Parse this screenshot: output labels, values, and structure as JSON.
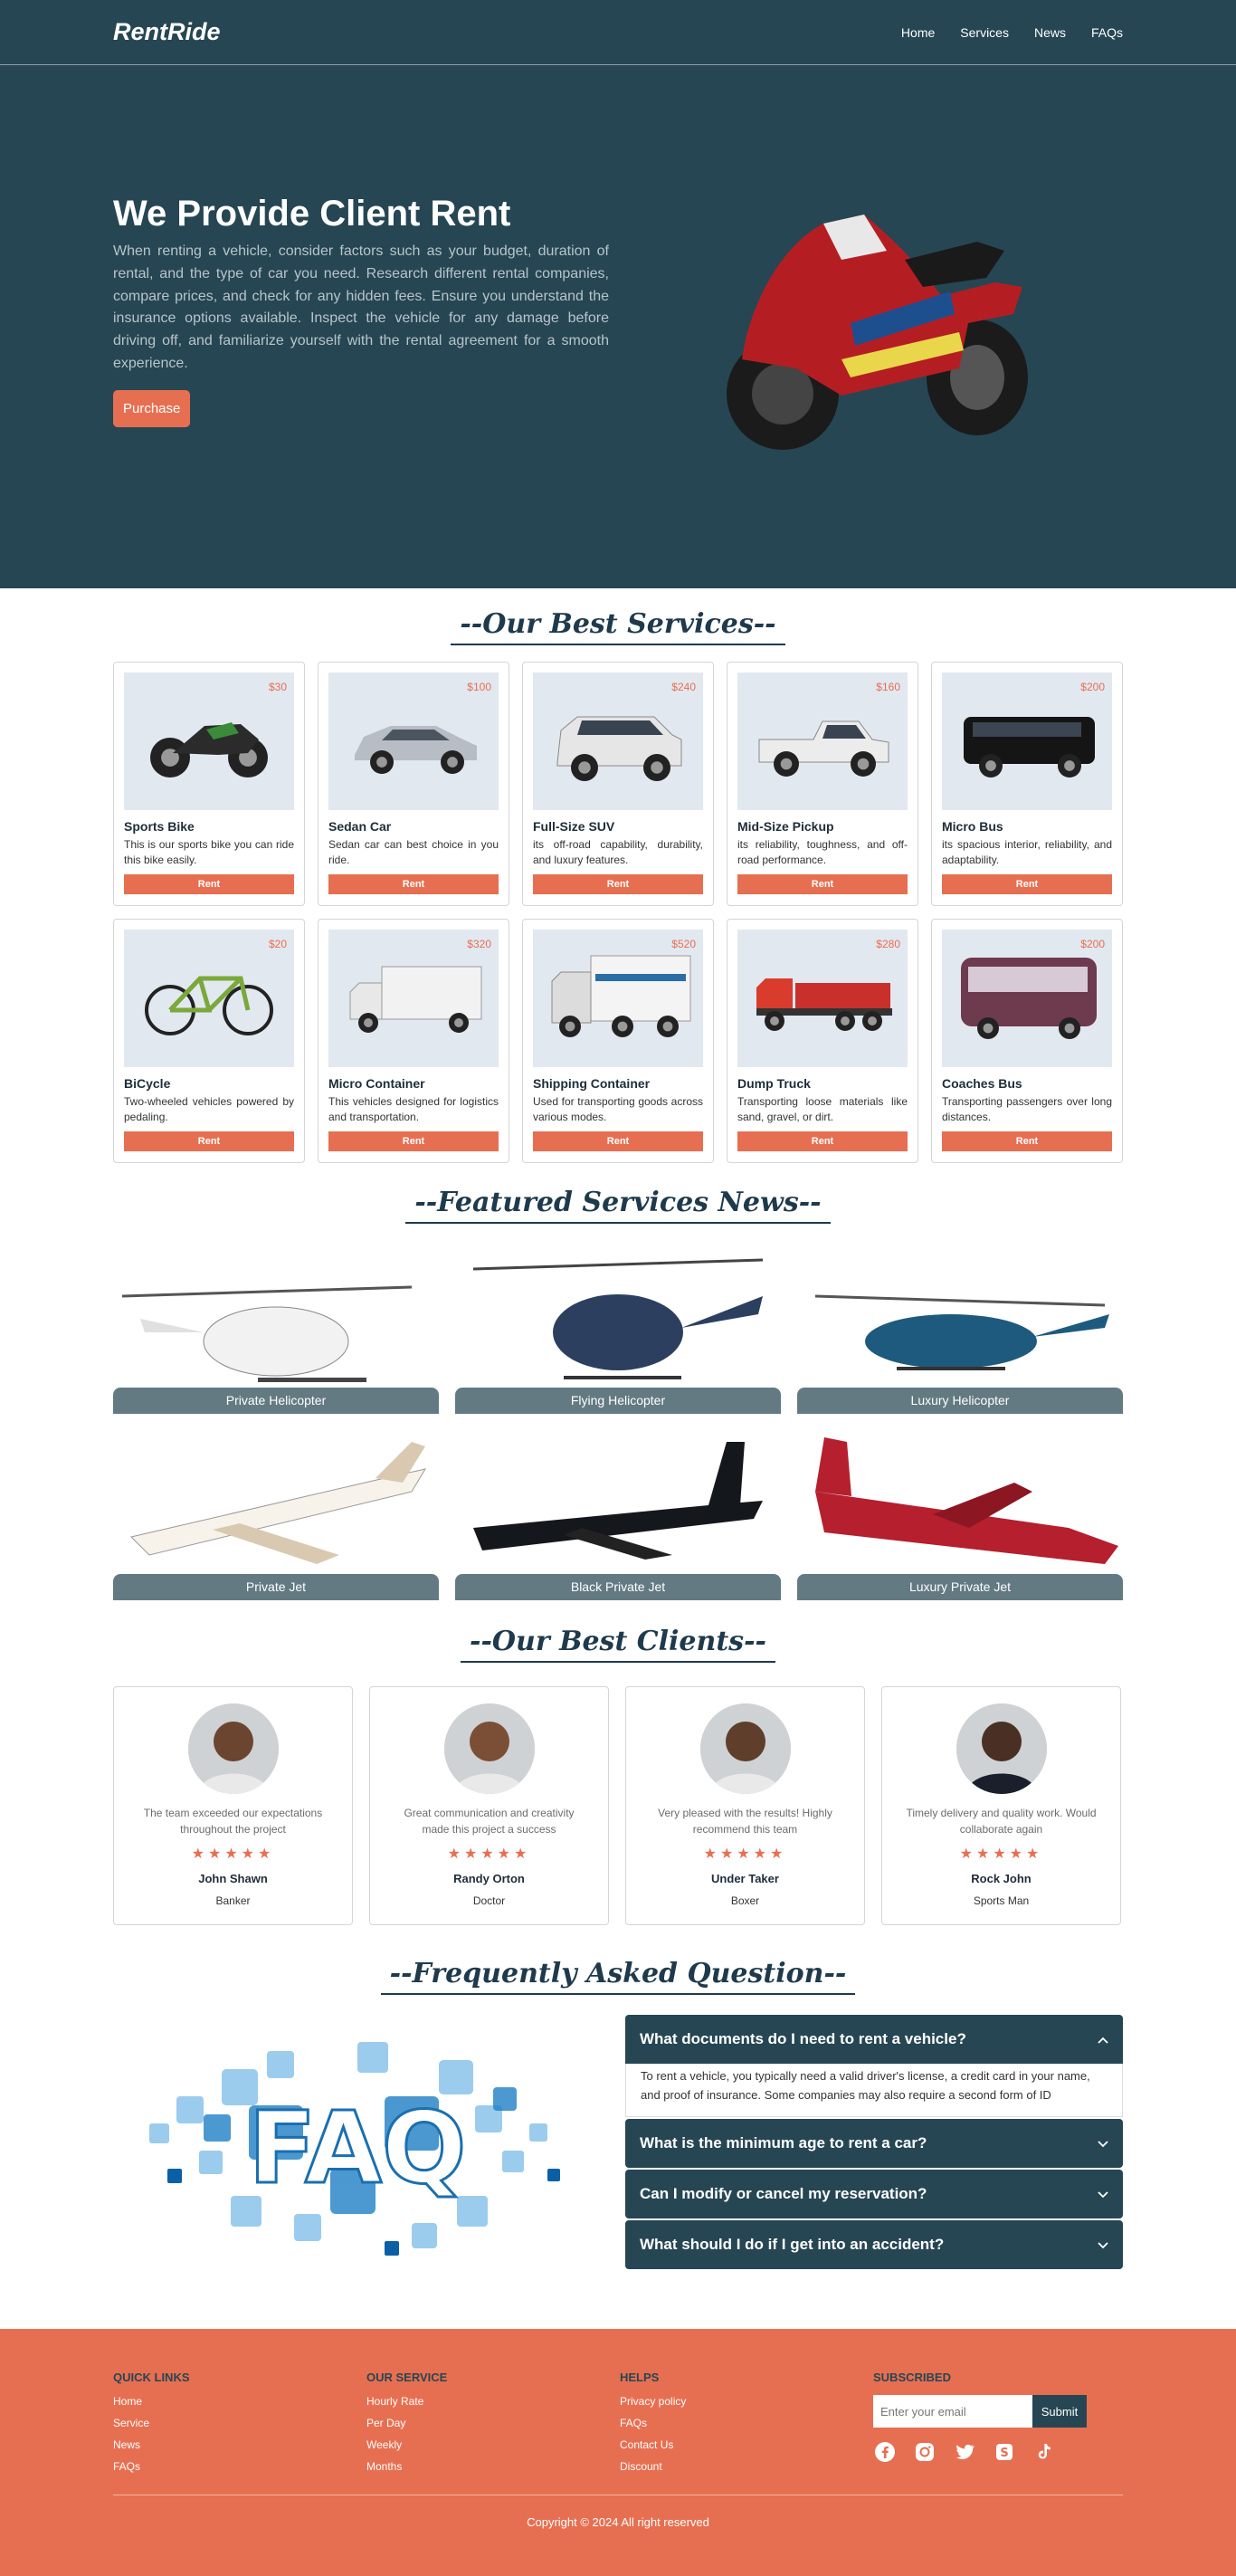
{
  "header": {
    "logo": "RentRide",
    "nav": [
      "Home",
      "Services",
      "News",
      "FAQs"
    ]
  },
  "hero": {
    "title": "We Provide Client Rent",
    "text": "When renting a vehicle, consider factors such as your budget, duration of rental, and the type of car you need. Research different rental companies, compare prices, and check for any hidden fees. Ensure you understand the insurance options available. Inspect the vehicle for any damage before driving off, and familiarize yourself with the rental agreement for a smooth experience.",
    "button": "Purchase",
    "image": "motorcycle-image"
  },
  "services": {
    "title": "--Our Best Services--",
    "items": [
      {
        "price": "$30",
        "name": "Sports Bike",
        "desc": "This is our sports bike you can ride this bike easily.",
        "button": "Rent",
        "icon": "sports-bike"
      },
      {
        "price": "$100",
        "name": "Sedan Car",
        "desc": "Sedan car can best choice in you ride.",
        "button": "Rent",
        "icon": "sedan"
      },
      {
        "price": "$240",
        "name": "Full-Size SUV",
        "desc": "its off-road capability, durability, and luxury features.",
        "button": "Rent",
        "icon": "suv"
      },
      {
        "price": "$160",
        "name": "Mid-Size Pickup",
        "desc": "its reliability, toughness, and off-road performance.",
        "button": "Rent",
        "icon": "pickup"
      },
      {
        "price": "$200",
        "name": "Micro Bus",
        "desc": "its spacious interior, reliability, and adaptability.",
        "button": "Rent",
        "icon": "micro-bus"
      },
      {
        "price": "$20",
        "name": "BiCycle",
        "desc": "Two-wheeled vehicles powered by pedaling.",
        "button": "Rent",
        "icon": "bicycle"
      },
      {
        "price": "$320",
        "name": "Micro Container",
        "desc": "This vehicles designed for logistics and transportation.",
        "button": "Rent",
        "icon": "box-truck"
      },
      {
        "price": "$520",
        "name": "Shipping Container",
        "desc": "Used for transporting goods across various modes.",
        "button": "Rent",
        "icon": "container-truck"
      },
      {
        "price": "$280",
        "name": "Dump Truck",
        "desc": "Transporting loose materials like sand, gravel, or dirt.",
        "button": "Rent",
        "icon": "dump-truck"
      },
      {
        "price": "$200",
        "name": "Coaches Bus",
        "desc": "Transporting passengers over long distances.",
        "button": "Rent",
        "icon": "coach-bus"
      }
    ]
  },
  "featured": {
    "title": "--Featured Services News--",
    "items": [
      {
        "label": "Private Helicopter",
        "icon": "white-helicopter"
      },
      {
        "label": "Flying Helicopter",
        "icon": "navy-helicopter"
      },
      {
        "label": "Luxury Helicopter",
        "icon": "blue-helicopter"
      },
      {
        "label": "Private Jet",
        "icon": "white-jet"
      },
      {
        "label": "Black Private Jet",
        "icon": "black-jet"
      },
      {
        "label": "Luxury Private Jet",
        "icon": "red-jet"
      }
    ]
  },
  "clients": {
    "title": "--Our Best Clients--",
    "items": [
      {
        "quote": "The team exceeded our expectations throughout the project",
        "stars": "★★★★★",
        "name": "John Shawn",
        "role": "Banker"
      },
      {
        "quote": "Great communication and creativity made this project a success",
        "stars": "★★★★★",
        "name": "Randy Orton",
        "role": "Doctor"
      },
      {
        "quote": "Very pleased with the results! Highly recommend this team",
        "stars": "★★★★★",
        "name": "Under Taker",
        "role": "Boxer"
      },
      {
        "quote": "Timely delivery and quality work. Would collaborate again",
        "stars": "★★★★★",
        "name": "Rock John",
        "role": "Sports Man"
      }
    ]
  },
  "faq": {
    "title": "--Frequently Asked Question--",
    "image_text": "FAQ",
    "items": [
      {
        "q": "What documents do I need to rent a vehicle?",
        "a": "To rent a vehicle, you typically need a valid driver's license, a credit card in your name, and proof of insurance. Some companies may also require a second form of ID",
        "open": true
      },
      {
        "q": "What is the minimum age to rent a car?",
        "open": false
      },
      {
        "q": "Can I modify or cancel my reservation?",
        "open": false
      },
      {
        "q": "What should I do if I get into an accident?",
        "open": false
      }
    ]
  },
  "footer": {
    "cols": [
      {
        "title": "QUICK LINKS",
        "links": [
          "Home",
          "Service",
          "News",
          "FAQs"
        ]
      },
      {
        "title": "OUR SERVICE",
        "links": [
          "Hourly Rate",
          "Per Day",
          "Weekly",
          "Months"
        ]
      },
      {
        "title": "HELPS",
        "links": [
          "Privacy policy",
          "FAQs",
          "Contact Us",
          "Discount"
        ]
      }
    ],
    "subscribe": {
      "title": "SUBSCRIBED",
      "placeholder": "Enter your email",
      "button": "Submit"
    },
    "socials": [
      "facebook-icon",
      "instagram-icon",
      "twitter-icon",
      "skype-icon",
      "tiktok-icon"
    ],
    "copyright": "Copyright © 2024 All right reserved"
  },
  "colors": {
    "primary": "#264653",
    "accent": "#e76f51",
    "card_bg": "#e2e8f0",
    "label_bg": "#637a83"
  }
}
